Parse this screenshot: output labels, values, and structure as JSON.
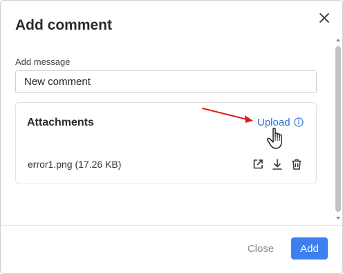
{
  "dialog": {
    "title": "Add comment",
    "close_icon": "close-icon"
  },
  "message": {
    "label": "Add message",
    "value": "New comment"
  },
  "attachments": {
    "title": "Attachments",
    "upload_label": "Upload",
    "info_icon": "info-icon",
    "files": [
      {
        "name": "error1.png (17.26 KB)",
        "actions": [
          "open-external-icon",
          "download-icon",
          "trash-icon"
        ]
      }
    ]
  },
  "footer": {
    "close_label": "Close",
    "add_label": "Add"
  },
  "colors": {
    "primary": "#3b7ff0",
    "link": "#2f6fdb",
    "annotation_arrow": "#d62020"
  }
}
